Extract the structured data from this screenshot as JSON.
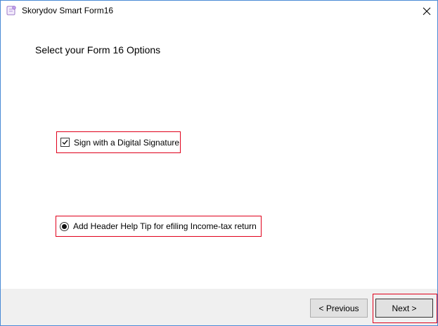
{
  "window": {
    "title": "Skorydov Smart Form16"
  },
  "main": {
    "heading": "Select your Form 16 Options",
    "options": [
      {
        "label": "Sign with a Digital Signature",
        "control": "checkbox",
        "checked": true
      },
      {
        "label": "Add Header Help Tip for efiling Income-tax return",
        "control": "radio",
        "checked": true
      }
    ]
  },
  "footer": {
    "previous_label": "< Previous",
    "next_label": "Next >"
  },
  "colors": {
    "highlight": "#e0001b",
    "window_border": "#4a8ad6",
    "footer_bg": "#f0f0f0"
  },
  "icons": {
    "app": "app-icon",
    "close": "close-icon"
  }
}
